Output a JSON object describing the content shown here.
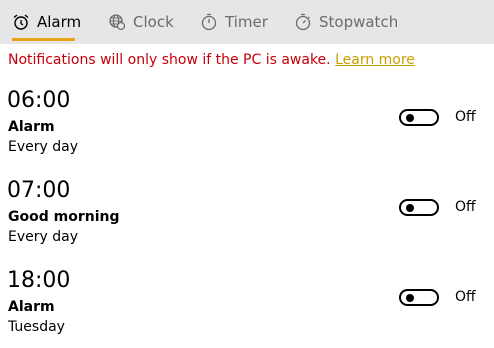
{
  "tabs": [
    {
      "label": "Alarm",
      "icon": "alarm-clock-icon",
      "active": true
    },
    {
      "label": "Clock",
      "icon": "world-clock-icon",
      "active": false
    },
    {
      "label": "Timer",
      "icon": "timer-icon",
      "active": false
    },
    {
      "label": "Stopwatch",
      "icon": "stopwatch-icon",
      "active": false
    }
  ],
  "notice": {
    "text": "Notifications will only show if the PC is awake.",
    "link": "Learn more"
  },
  "alarms": [
    {
      "time": "06:00",
      "name": "Alarm",
      "repeat": "Every day",
      "state": "Off"
    },
    {
      "time": "07:00",
      "name": "Good morning",
      "repeat": "Every day",
      "state": "Off"
    },
    {
      "time": "18:00",
      "name": "Alarm",
      "repeat": "Tuesday",
      "state": "Off"
    }
  ],
  "colors": {
    "accent": "#e8a317",
    "notice": "#c4000a",
    "link": "#c8a100",
    "tabbar": "#e6e6e6"
  }
}
